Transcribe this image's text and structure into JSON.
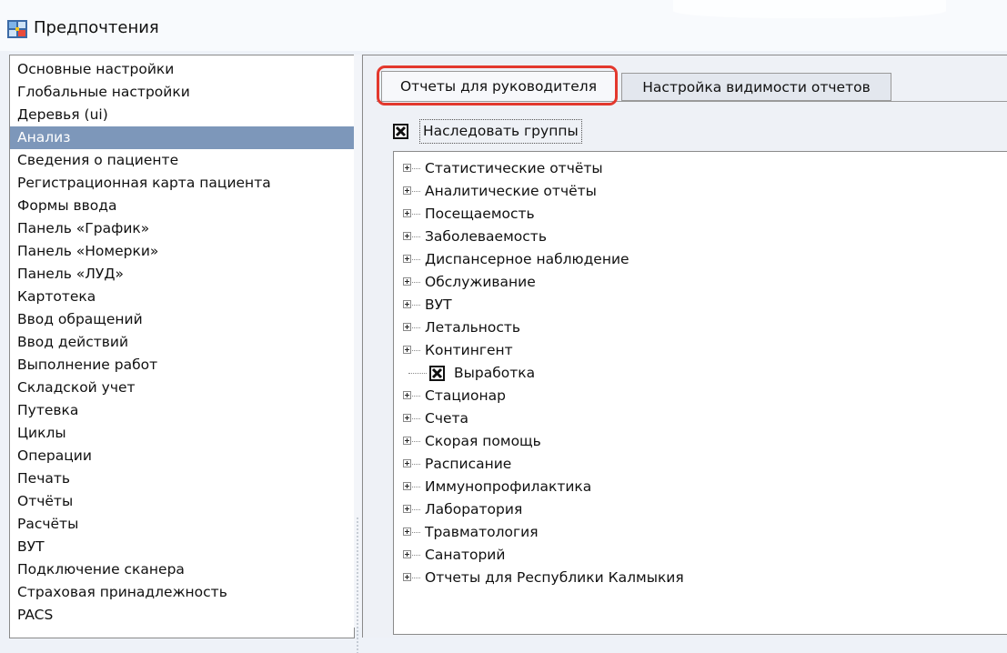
{
  "window": {
    "title": "Предпочтения",
    "icon": "preferences-app-icon"
  },
  "sidebar": {
    "items": [
      {
        "label": "Основные настройки"
      },
      {
        "label": "Глобальные настройки"
      },
      {
        "label": "Деревья (ui)"
      },
      {
        "label": "Анализ",
        "selected": true
      },
      {
        "label": "Сведения о пациенте"
      },
      {
        "label": "Регистрационная карта пациента"
      },
      {
        "label": "Формы ввода"
      },
      {
        "label": "Панель «График»"
      },
      {
        "label": "Панель «Номерки»"
      },
      {
        "label": "Панель «ЛУД»"
      },
      {
        "label": "Картотека"
      },
      {
        "label": "Ввод обращений"
      },
      {
        "label": "Ввод действий"
      },
      {
        "label": "Выполнение работ"
      },
      {
        "label": "Складской учет"
      },
      {
        "label": "Путевка"
      },
      {
        "label": "Циклы"
      },
      {
        "label": "Операции"
      },
      {
        "label": "Печать"
      },
      {
        "label": "Отчёты"
      },
      {
        "label": "Расчёты"
      },
      {
        "label": "ВУТ"
      },
      {
        "label": "Подключение сканера"
      },
      {
        "label": "Страховая принадлежность"
      },
      {
        "label": "PACS"
      }
    ]
  },
  "tabs": [
    {
      "label": "Отчеты для руководителя",
      "active": true
    },
    {
      "label": "Настройка видимости отчетов",
      "active": false
    }
  ],
  "inherit_groups": {
    "label": "Наследовать группы",
    "checked": true
  },
  "tree": {
    "items": [
      {
        "label": "Статистические отчёты",
        "type": "folder"
      },
      {
        "label": "Аналитические отчёты",
        "type": "folder"
      },
      {
        "label": "Посещаемость",
        "type": "folder"
      },
      {
        "label": "Заболеваемость",
        "type": "folder"
      },
      {
        "label": "Диспансерное наблюдение",
        "type": "folder"
      },
      {
        "label": "Обслуживание",
        "type": "folder"
      },
      {
        "label": "ВУТ",
        "type": "folder"
      },
      {
        "label": "Летальность",
        "type": "folder"
      },
      {
        "label": "Контингент",
        "type": "folder"
      },
      {
        "label": "Выработка",
        "type": "checkbox",
        "checked": true
      },
      {
        "label": "Стационар",
        "type": "folder"
      },
      {
        "label": "Счета",
        "type": "folder"
      },
      {
        "label": "Скорая помощь",
        "type": "folder"
      },
      {
        "label": "Расписание",
        "type": "folder"
      },
      {
        "label": "Иммунопрофилактика",
        "type": "folder"
      },
      {
        "label": "Лаборатория",
        "type": "folder"
      },
      {
        "label": "Травматология",
        "type": "folder"
      },
      {
        "label": "Санаторий",
        "type": "folder"
      },
      {
        "label": "Отчеты для Республики Калмыкия",
        "type": "folder"
      }
    ]
  },
  "colors": {
    "selection": "#7d97ba",
    "highlight": "#e3382d",
    "background": "#eef2f8"
  }
}
